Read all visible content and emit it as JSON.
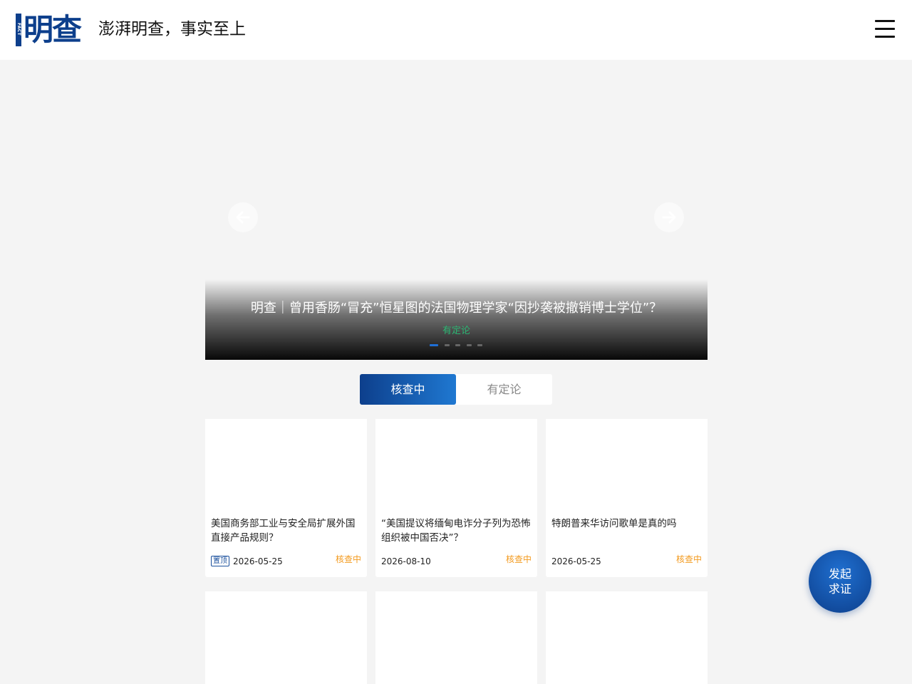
{
  "header": {
    "logo_text": "明查",
    "logo_side_text": "FACT PAPER",
    "slogan": "澎湃明查，事实至上",
    "menu_icon": "hamburger-menu-icon"
  },
  "carousel": {
    "title": "明查｜曾用香肠“冒充”恒星图的法国物理学家“因抄袭被撤销博士学位”？",
    "status": "有定论",
    "prev_icon": "arrow-left-icon",
    "next_icon": "arrow-right-icon",
    "slide_count": 5,
    "active_slide": 1
  },
  "tabs": [
    {
      "label": "核查中",
      "active": true
    },
    {
      "label": "有定论",
      "active": false
    }
  ],
  "cards": [
    {
      "title": "美国商务部工业与安全局扩展外国直接产品规则？",
      "pinned": true,
      "pin_label": "置顶",
      "date": "2026-05-25",
      "status": "核查中"
    },
    {
      "title": "“美国提议将缅甸电诈分子列为恐怖组织被中国否决”？",
      "pinned": false,
      "date": "2026-08-10",
      "status": "核查中"
    },
    {
      "title": "特朗普来华访问歌单是真的吗",
      "pinned": false,
      "date": "2026-05-25",
      "status": "核查中"
    },
    {
      "title": "",
      "date": "",
      "status": ""
    },
    {
      "title": "",
      "date": "",
      "status": ""
    },
    {
      "title": "",
      "date": "",
      "status": ""
    }
  ],
  "float_button": {
    "line1": "发起",
    "line2": "求证"
  },
  "colors": {
    "brand_blue": "#0d3f8c",
    "accent_blue": "#1f78d1",
    "status_checking": "#f39a1e",
    "status_concluded": "#2bb673",
    "page_bg": "#f4f4f4"
  }
}
